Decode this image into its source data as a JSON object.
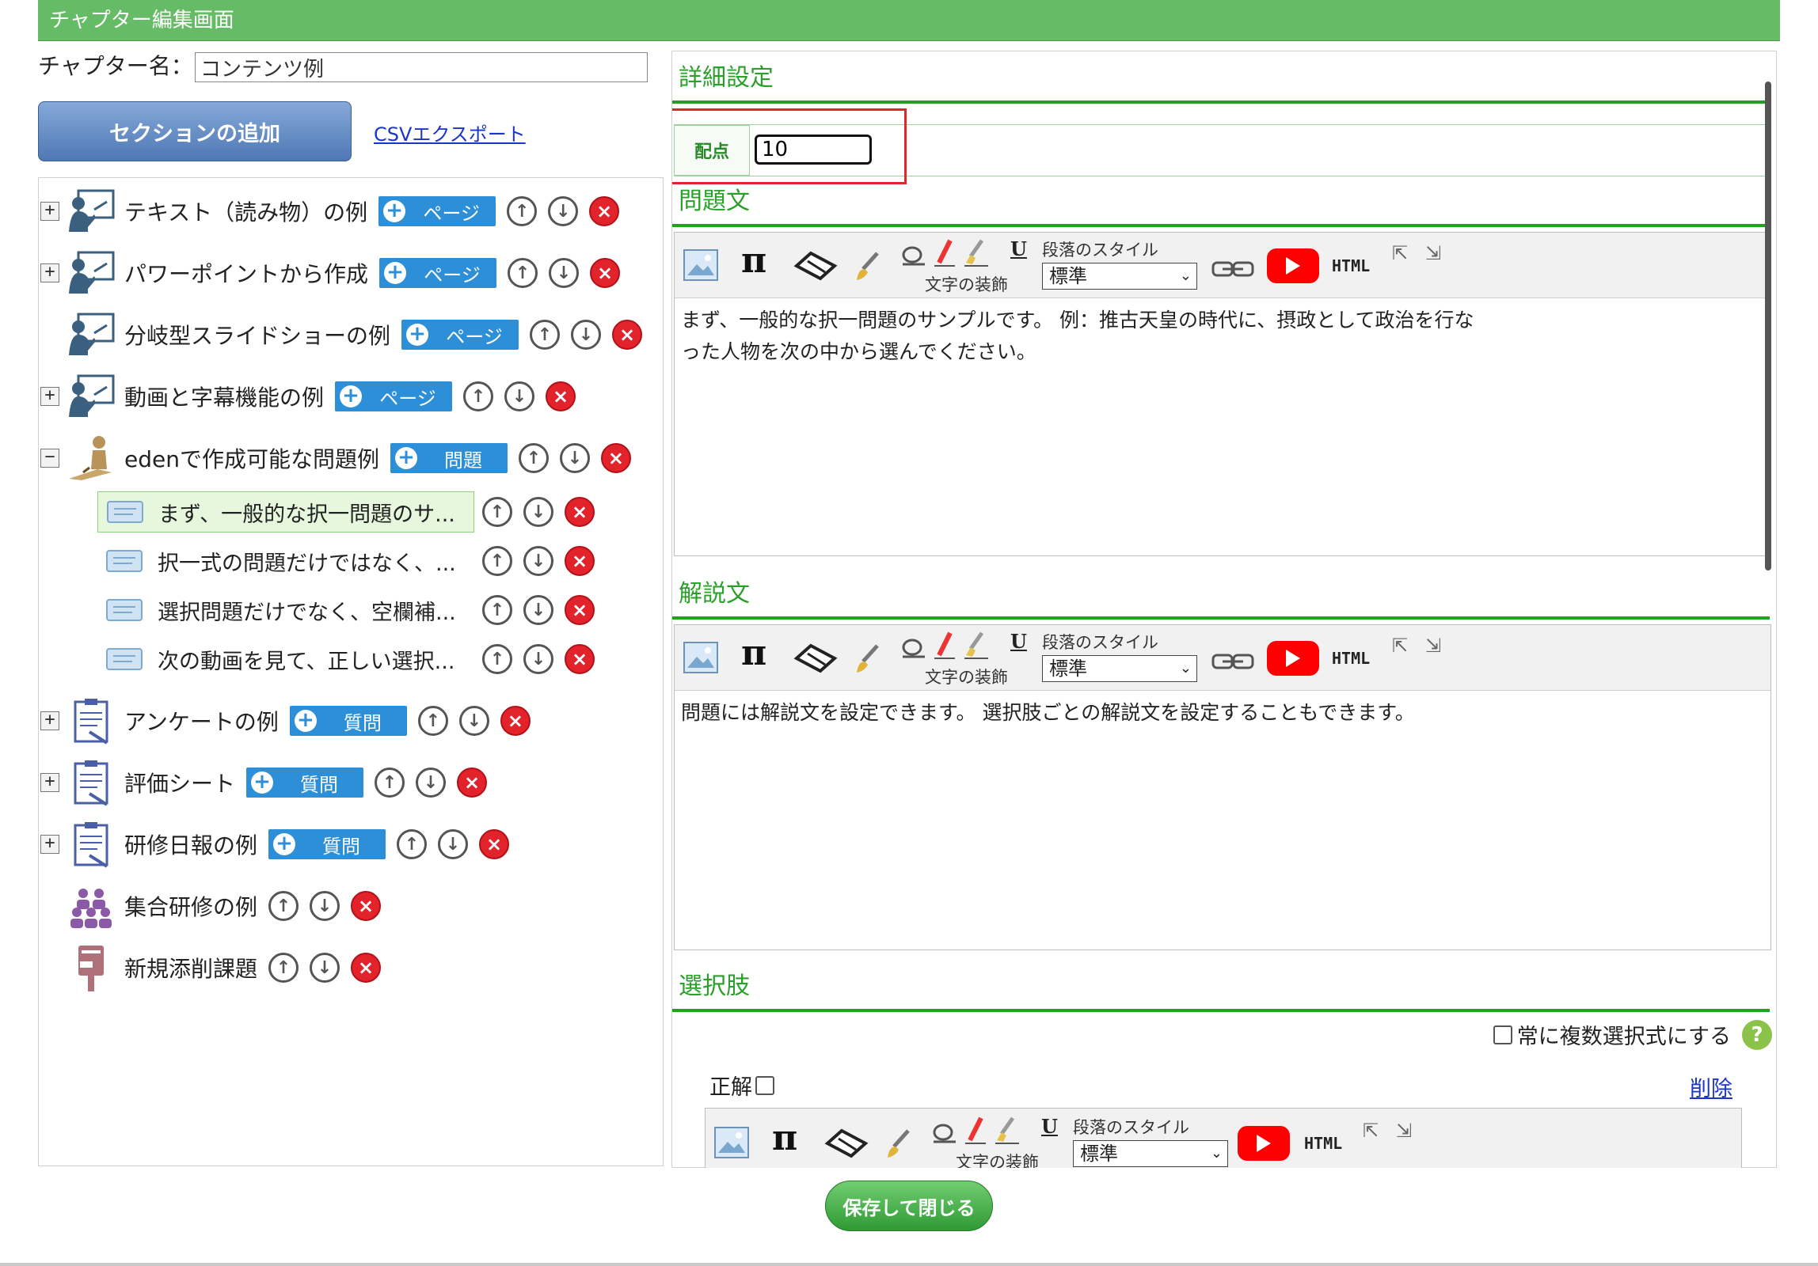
{
  "window": {
    "title": "チャプター編集画面"
  },
  "chapter": {
    "name_label": "チャプター名：",
    "name_value": "コンテンツ例"
  },
  "actions": {
    "add_section": "セクションの追加",
    "csv_export": "CSVエクスポート",
    "save_close": "保存して閉じる"
  },
  "tree": {
    "nodes": [
      {
        "label": "テキスト（読み物）の例",
        "tag": "ページ",
        "expander": "+"
      },
      {
        "label": "パワーポイントから作成",
        "tag": "ページ",
        "expander": "+"
      },
      {
        "label": "分岐型スライドショーの例",
        "tag": "ページ",
        "expander": ""
      },
      {
        "label": "動画と字幕機能の例",
        "tag": "ページ",
        "expander": "+"
      },
      {
        "label": "edenで作成可能な問題例",
        "tag": "問題",
        "expander": "−"
      },
      {
        "label": "アンケートの例",
        "tag": "質問",
        "expander": "+"
      },
      {
        "label": "評価シート",
        "tag": "質問",
        "expander": "+"
      },
      {
        "label": "研修日報の例",
        "tag": "質問",
        "expander": "+"
      },
      {
        "label": "集合研修の例",
        "tag": "",
        "expander": ""
      },
      {
        "label": "新規添削課題",
        "tag": "",
        "expander": ""
      }
    ],
    "children": [
      {
        "label": "まず、一般的な択一問題のサ..."
      },
      {
        "label": "択一式の問題だけではなく、..."
      },
      {
        "label": "選択問題だけでなく、空欄補..."
      },
      {
        "label": "次の動画を見て、正しい選択..."
      }
    ]
  },
  "detail": {
    "title": "詳細設定",
    "score_label": "配点",
    "score_value": "10"
  },
  "question": {
    "title": "問題文",
    "text_line1": "まず、一般的な択一問題のサンプルです。 例：推古天皇の時代に、摂政として政治を行な",
    "text_line2": "った人物を次の中から選んでください。"
  },
  "explanation": {
    "title": "解説文",
    "text": "問題には解説文を設定できます。 選択肢ごとの解説文を設定することもできます。"
  },
  "choices": {
    "title": "選択肢",
    "always_multi": "常に複数選択式にする",
    "help": "?",
    "correct_label": "正解",
    "delete": "削除"
  },
  "toolbar": {
    "paragraph_style": "段落のスタイル",
    "text_decoration": "文字の装飾",
    "style_value": "標準",
    "html": "HTML",
    "pi": "π",
    "underline": "U"
  },
  "icons": {
    "expand": "+",
    "collapse": "−",
    "add": "+",
    "up": "↑",
    "down": "↓",
    "delete": "×",
    "expand_arrow": "⇱",
    "shrink_arrow": "⇲",
    "select_arrow": "⌄"
  },
  "colors": {
    "title_bar": "#66bb66",
    "accent_green": "#22a022",
    "tag_blue": "#2d8fd8",
    "delete_red": "#e2232c",
    "highlight": "#e0262c"
  }
}
